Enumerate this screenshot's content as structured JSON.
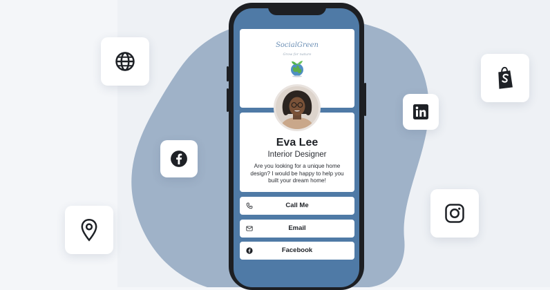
{
  "profile": {
    "logo_text": "SocialGreen",
    "logo_tagline": "Grow for nature",
    "name": "Eva Lee",
    "job_title": "Interior Designer",
    "bio": "Are you looking for a unique home design? I would be happy to help you built your dream home!"
  },
  "actions": [
    {
      "label": "Call Me",
      "icon": "phone-icon"
    },
    {
      "label": "Email",
      "icon": "mail-icon"
    },
    {
      "label": "Facebook",
      "icon": "facebook-icon"
    }
  ],
  "floating_icons": [
    "globe-icon",
    "facebook-icon",
    "location-pin-icon",
    "linkedin-icon",
    "shopify-icon",
    "instagram-icon"
  ],
  "colors": {
    "blob": "#9fb2c8",
    "phone_screen": "#4f7aa6",
    "icon_dark": "#1e2126"
  }
}
